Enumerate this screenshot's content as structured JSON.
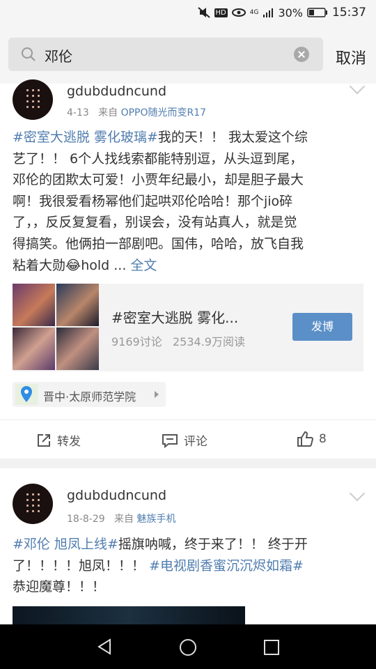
{
  "status_bar": {
    "battery": "30%",
    "time": "15:37",
    "network": "4G",
    "hd": "HD"
  },
  "search": {
    "query": "邓伦",
    "cancel_label": "取消"
  },
  "posts": [
    {
      "username": "gdubdudncund",
      "date": "4-13",
      "via": "来自",
      "source": "OPPO随光而变R17",
      "tag1": "#密室大逃脱 雾化玻璃#",
      "lines": [
        "我的天！！ 我太爱这个综",
        "艺了！！ 6个人找线索都能特别逗，从头逗到尾，",
        "邓伦的团欺太可爱！小贾年纪最小，却是胆子最大",
        "啊！我很爱看杨幂他们起哄邓伦哈哈！那个jio碎",
        "了，，反反复复看，别误会，没有站真人，就是觉",
        "得搞笑。他俩拍一部剧吧。国伟，哈哈，放飞自我",
        "粘着大勋😂hold ... "
      ],
      "full_text_link": "全文",
      "topic": {
        "title": "#密室大逃脱 雾化...",
        "discussions": "9169讨论",
        "reads": "2534.9万阅读",
        "button": "发博"
      },
      "location": "晋中·太原师范学院",
      "actions": {
        "repost": "转发",
        "comment": "评论",
        "likes": "8"
      }
    },
    {
      "username": "gdubdudncund",
      "date": "18-8-29",
      "via": "来自",
      "source": "魅族手机",
      "tag1": "#邓伦 旭凤上线#",
      "line1_rest": "摇旗呐喊，终于来了！！ 终于开",
      "line2_text": "了！！！！旭凤！！！ ",
      "tag2": "#电视剧香蜜沉沉烬如霜#",
      "line3": "恭迎魔尊！！！"
    }
  ],
  "colors": {
    "link": "#507daf",
    "button": "#5b8fc8"
  }
}
